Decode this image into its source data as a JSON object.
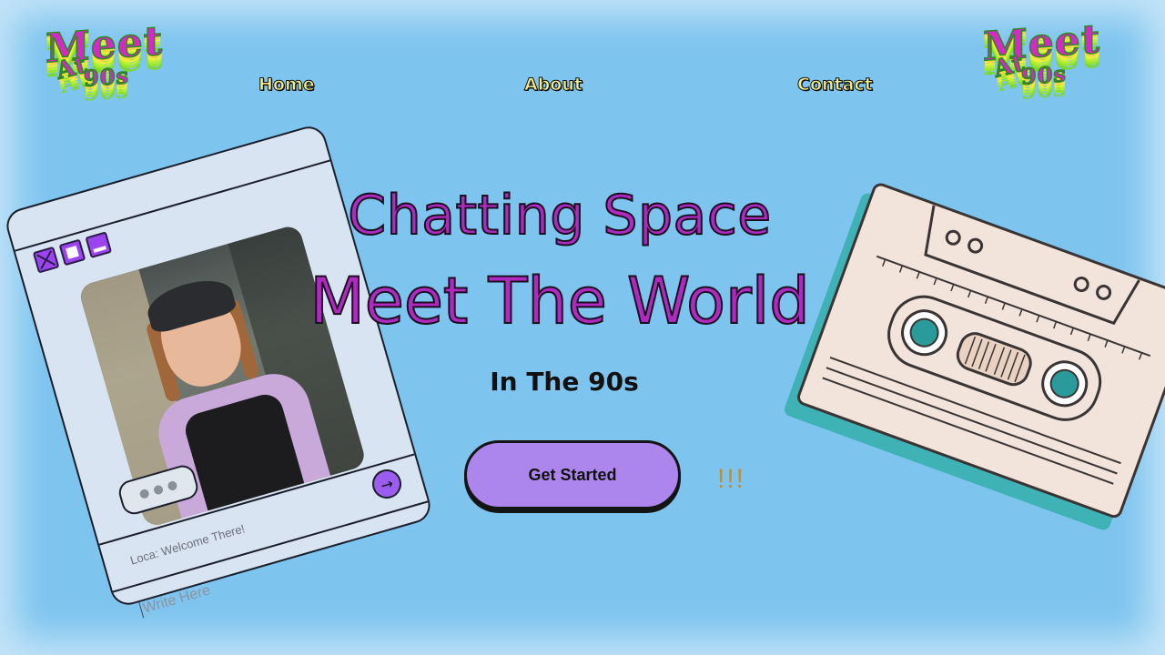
{
  "logo": {
    "line1": "Meet",
    "line2": "90s",
    "line3": "At"
  },
  "nav": {
    "home": "Home",
    "about": "About",
    "contact": "Contact"
  },
  "chat_card": {
    "bubble_icon": "typing-dots-icon",
    "message": "Loca:  Welcome There!",
    "input_placeholder": "Write Here",
    "send_icon": "arrow-right-icon"
  },
  "hero": {
    "line1": "Chatting Space",
    "line2": "Meet The World",
    "subtitle": "In The 90s",
    "cta_label": "Get Started",
    "exclaim": "!!!"
  },
  "colors": {
    "background": "#7dc4ef",
    "headline": "#b02ac0",
    "cta": "#ac86ec",
    "accent_orange": "#d68a18"
  }
}
